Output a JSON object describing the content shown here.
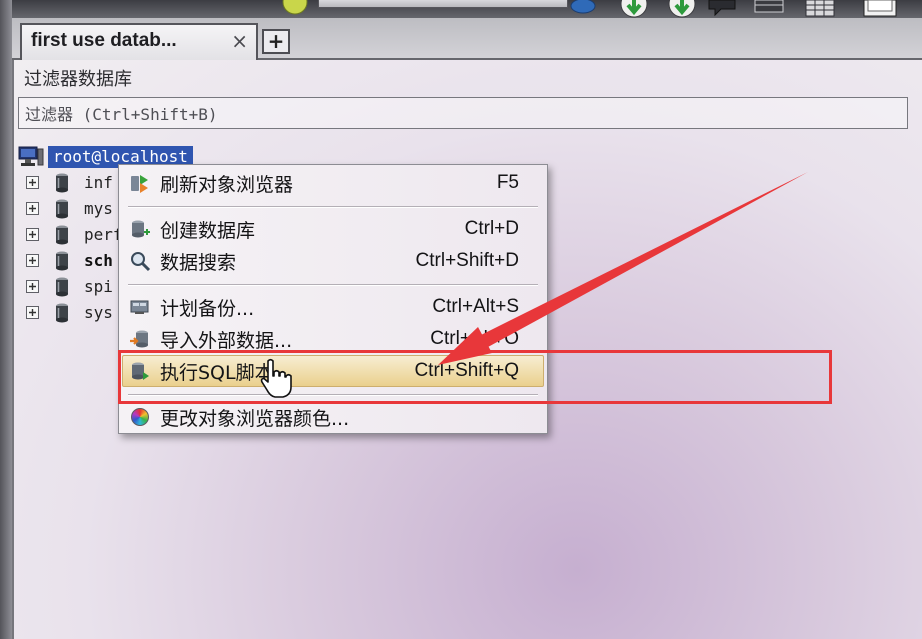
{
  "toolbar": {
    "icons": [
      "new-connection-icon",
      "database-icon",
      "download-arrow-icon",
      "download-arrow-icon",
      "chat-bubble-icon",
      "table-icon",
      "grid-icon",
      "window-icon"
    ]
  },
  "tabs": [
    {
      "label": "first use datab...",
      "close": "×"
    }
  ],
  "new_tab_label": "+",
  "object_browser": {
    "filter_label": "过滤器数据库",
    "filter_placeholder": "过滤器 (Ctrl+Shift+B)",
    "root": {
      "label": "root@localhost",
      "icon": "server-icon"
    },
    "databases": [
      {
        "name": "inf",
        "icon": "database-icon"
      },
      {
        "name": "mys",
        "icon": "database-icon"
      },
      {
        "name": "perf",
        "icon": "database-icon"
      },
      {
        "name": "sch",
        "icon": "database-icon"
      },
      {
        "name": "spi",
        "icon": "database-icon"
      },
      {
        "name": "sys",
        "icon": "database-icon"
      }
    ]
  },
  "context_menu": {
    "highlighted_index": 5,
    "items": [
      {
        "label": "刷新对象浏览器",
        "shortcut": "F5",
        "icon": "refresh-icon"
      },
      {
        "label": "创建数据库",
        "shortcut": "Ctrl+D",
        "icon": "create-database-icon"
      },
      {
        "label": "数据搜索",
        "shortcut": "Ctrl+Shift+D",
        "icon": "search-icon"
      },
      {
        "label": "计划备份...",
        "shortcut": "Ctrl+Alt+S",
        "icon": "schedule-backup-icon"
      },
      {
        "label": "导入外部数据...",
        "shortcut": "Ctrl+Alt+O",
        "icon": "import-icon"
      },
      {
        "label": "执行SQL脚本",
        "shortcut": "Ctrl+Shift+Q",
        "icon": "sql-script-icon"
      },
      {
        "label": "更改对象浏览器颜色...",
        "shortcut": "",
        "icon": "color-wheel-icon"
      }
    ]
  },
  "colors": {
    "selection": "#2f55b0",
    "menu_highlight": "#ead08d",
    "annotation": "#e8373a"
  }
}
